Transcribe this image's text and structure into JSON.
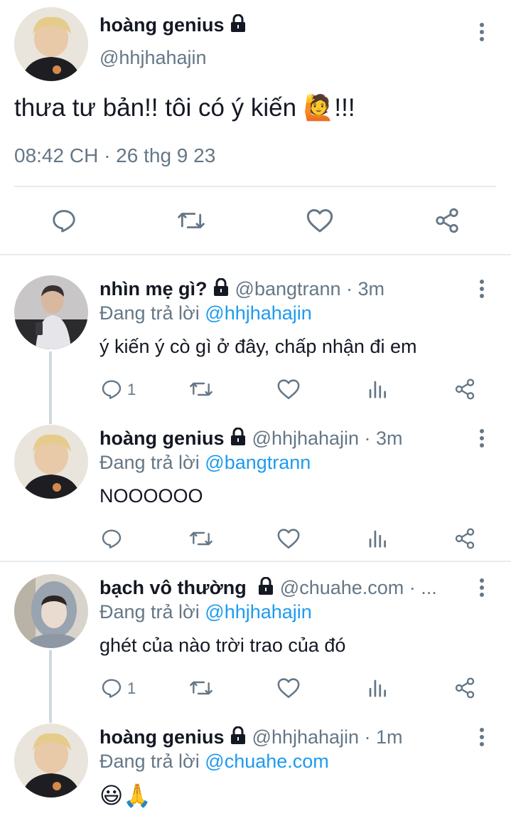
{
  "main_tweet": {
    "display_name": "hoàng genius",
    "handle": "@hhjhahajin",
    "text": "thưa tư bản!! tôi có ý kiến 🙋!!!",
    "timestamp": "08:42 CH · 26 thg 9 23"
  },
  "replies": [
    {
      "display_name": "nhìn mẹ gì?",
      "meta": "@bangtrann · 3m",
      "replying_prefix": "Đang trả lời",
      "replying_to": "@hhjhahajin",
      "text": "ý kiến ý cò gì ở đây, chấp nhận đi em",
      "reply_count": "1"
    },
    {
      "display_name": "hoàng genius",
      "meta": "@hhjhahajin · 3m",
      "replying_prefix": "Đang trả lời",
      "replying_to": "@bangtrann",
      "text": "NOOOOOO",
      "reply_count": ""
    },
    {
      "display_name": "bạch vô thường",
      "meta": "@chuahe.com · ...",
      "replying_prefix": "Đang trả lời",
      "replying_to": "@hhjhahajin",
      "text": "ghét của nào trời trao của đó",
      "reply_count": "1"
    },
    {
      "display_name": "hoàng genius",
      "meta": "@hhjhahajin · 1m",
      "replying_prefix": "Đang trả lời",
      "replying_to": "@chuahe.com",
      "text": "😃🙏",
      "reply_count": ""
    }
  ],
  "icons": {
    "lock": "lock-icon",
    "reply": "reply-icon",
    "retweet": "retweet-icon",
    "like": "heart-icon",
    "share": "share-icon",
    "stats": "analytics-icon",
    "more": "more-icon"
  },
  "colors": {
    "accent": "#1d9bf0",
    "secondary_text": "#657786",
    "primary_text": "#141823"
  }
}
